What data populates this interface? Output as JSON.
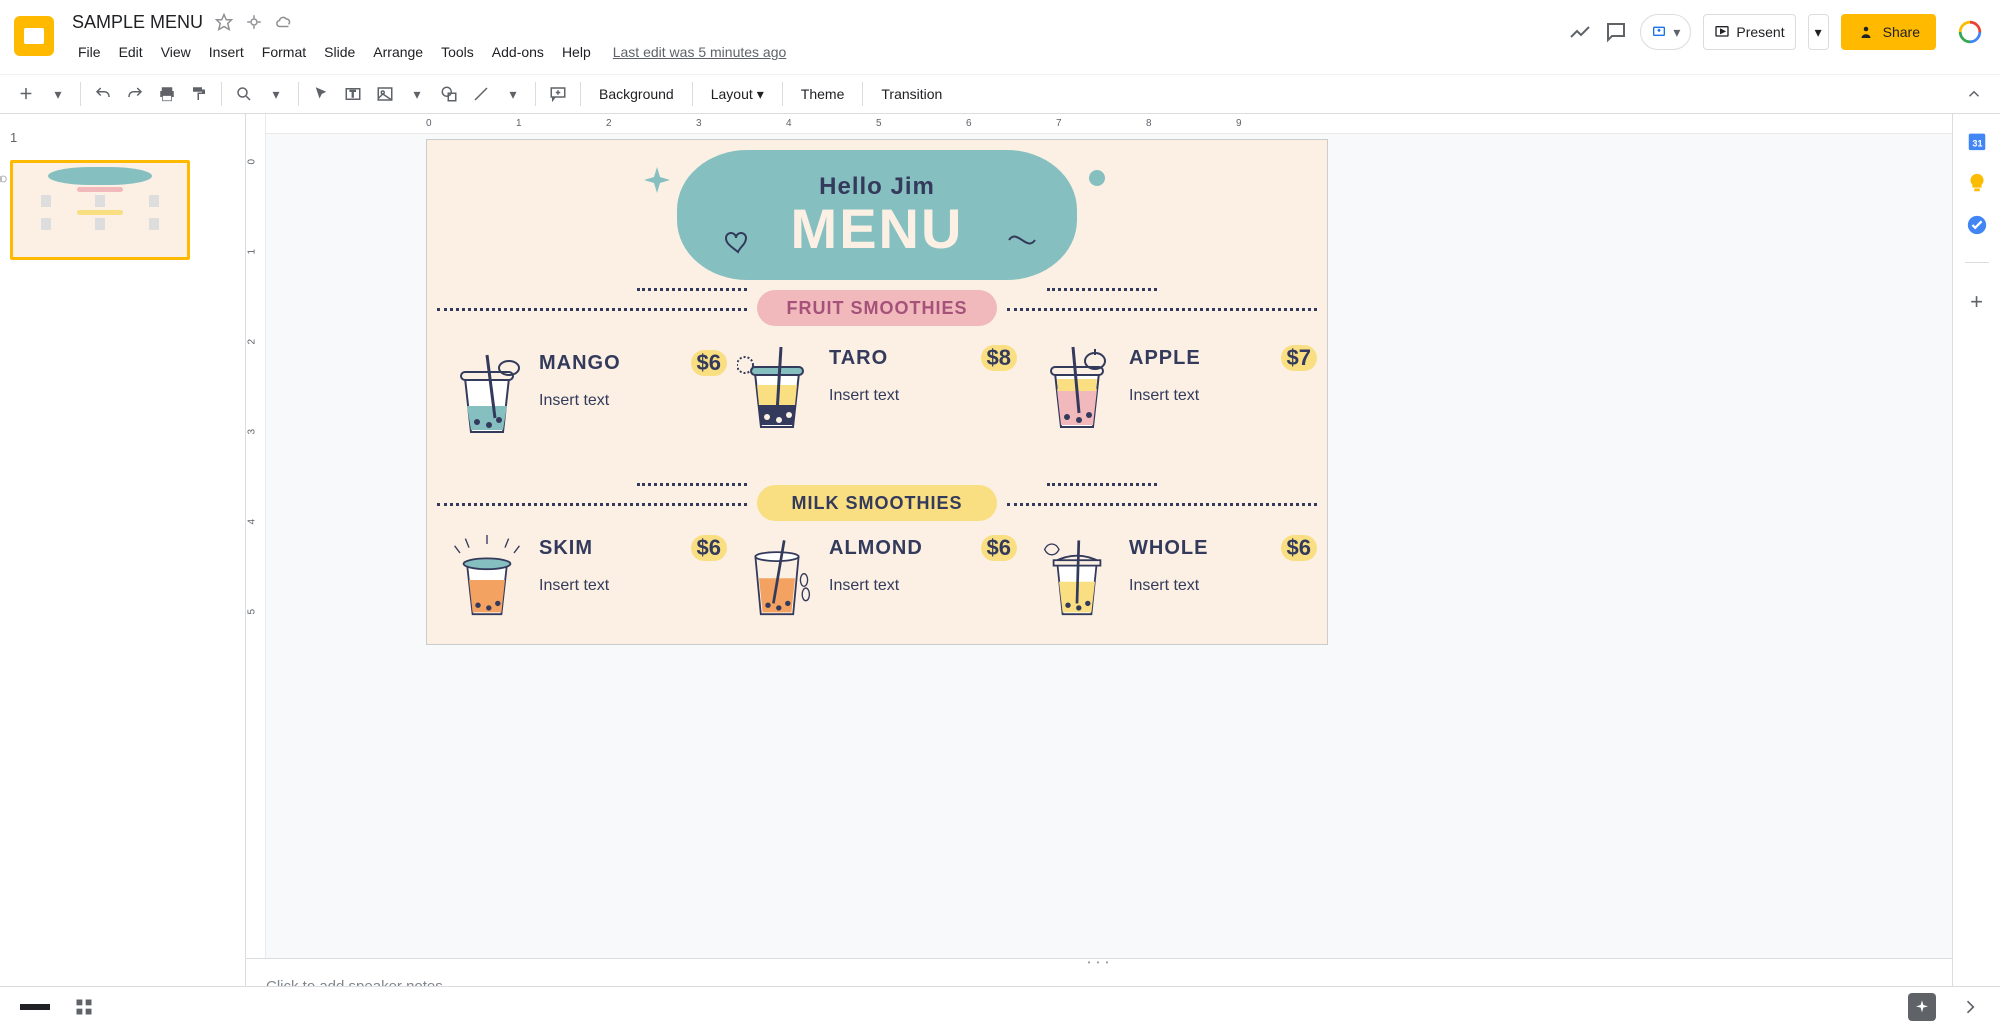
{
  "doc": {
    "title": "SAMPLE MENU"
  },
  "menubar": {
    "file": "File",
    "edit": "Edit",
    "view": "View",
    "insert": "Insert",
    "format": "Format",
    "slide": "Slide",
    "arrange": "Arrange",
    "tools": "Tools",
    "addons": "Add-ons",
    "help": "Help",
    "last_edit": "Last edit was 5 minutes ago"
  },
  "header": {
    "present": "Present",
    "share": "Share"
  },
  "toolbar": {
    "background": "Background",
    "layout": "Layout",
    "theme": "Theme",
    "transition": "Transition"
  },
  "slide": {
    "greeting": "Hello Jim",
    "title": "MENU",
    "cat1": "FRUIT SMOOTHIES",
    "cat2": "MILK SMOOTHIES",
    "placeholder": "Insert text",
    "items": {
      "mango": {
        "name": "MANGO",
        "price": "$6"
      },
      "taro": {
        "name": "TARO",
        "price": "$8"
      },
      "apple": {
        "name": "APPLE",
        "price": "$7"
      },
      "skim": {
        "name": "SKIM",
        "price": "$6"
      },
      "almond": {
        "name": "ALMOND",
        "price": "$6"
      },
      "whole": {
        "name": "WHOLE",
        "price": "$6"
      }
    }
  },
  "notes": {
    "placeholder": "Click to add speaker notes"
  },
  "ruler_h": [
    "0",
    "1",
    "2",
    "3",
    "4",
    "5",
    "6",
    "7",
    "8",
    "9"
  ],
  "ruler_v": [
    "0",
    "1",
    "2",
    "3",
    "4",
    "5"
  ]
}
